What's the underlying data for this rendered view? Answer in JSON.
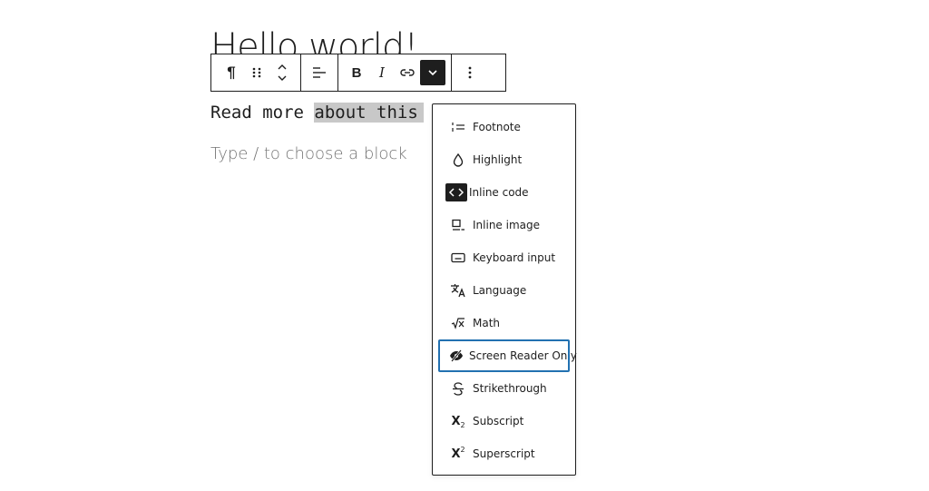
{
  "editor": {
    "post_title": "Hello world!",
    "paragraph": {
      "text_before": "Read more ",
      "text_selected": "about this"
    },
    "placeholder": "Type / to choose a block"
  },
  "toolbar": {
    "paragraph_icon": "¶",
    "items": [
      {
        "name": "paragraph-icon"
      },
      {
        "name": "drag-handle-icon"
      },
      {
        "name": "move-up-down"
      },
      {
        "name": "align-icon"
      },
      {
        "name": "bold-icon",
        "label": "B"
      },
      {
        "name": "italic-icon",
        "label": "I"
      },
      {
        "name": "link-icon"
      },
      {
        "name": "more-rich-text-chevron-icon"
      },
      {
        "name": "options-more-vertical-icon"
      }
    ]
  },
  "format_menu": {
    "items": [
      {
        "label": "Footnote",
        "icon": "footnote-icon"
      },
      {
        "label": "Highlight",
        "icon": "droplet-icon"
      },
      {
        "label": "Inline code",
        "icon": "code-icon"
      },
      {
        "label": "Inline image",
        "icon": "inline-image-icon"
      },
      {
        "label": "Keyboard input",
        "icon": "keyboard-icon"
      },
      {
        "label": "Language",
        "icon": "translate-icon"
      },
      {
        "label": "Math",
        "icon": "math-icon"
      },
      {
        "label": "Screen Reader Only",
        "icon": "eye-hidden-icon",
        "focused": true
      },
      {
        "label": "Strikethrough",
        "icon": "strikethrough-icon"
      },
      {
        "label": "Subscript",
        "icon": "subscript-icon"
      },
      {
        "label": "Superscript",
        "icon": "superscript-icon"
      }
    ]
  },
  "colors": {
    "text": "#1e1e1e",
    "selection": "#c8c8c8",
    "placeholder": "#757575",
    "focus_outline": "#2271b1"
  }
}
